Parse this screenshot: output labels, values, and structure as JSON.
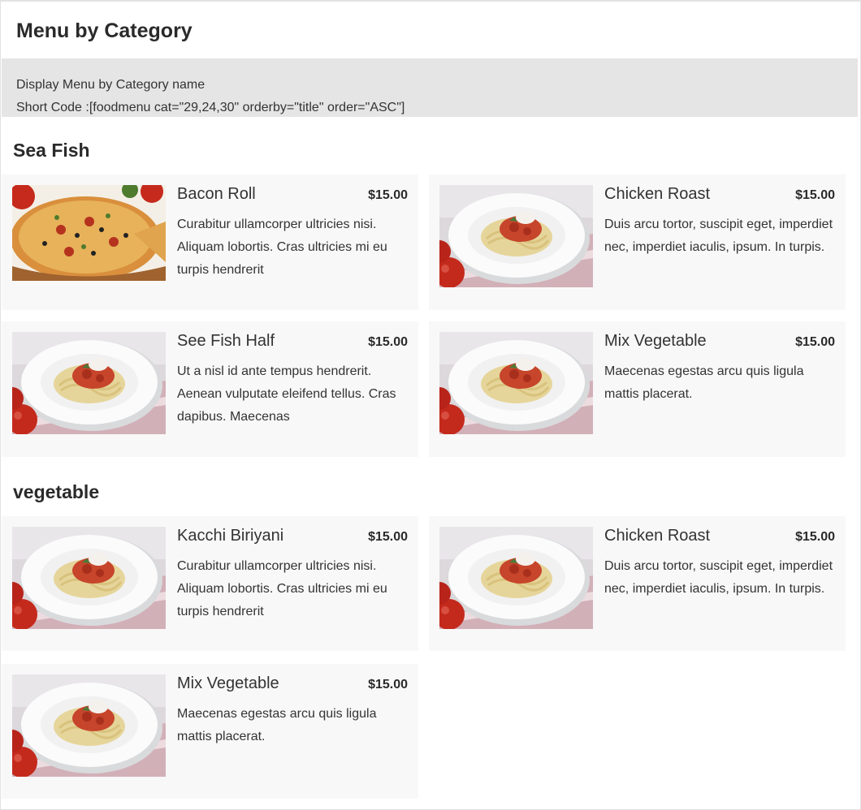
{
  "page": {
    "title": "Menu by Category",
    "info_line1": "Display Menu by Category name",
    "info_line2": "Short Code :[foodmenu cat=\"29,24,30\" orderby=\"title\" order=\"ASC\"]"
  },
  "categories": [
    {
      "name": "Sea Fish",
      "items": [
        {
          "title": "Bacon Roll",
          "price": "$15.00",
          "desc": "Curabitur ullamcorper ultricies nisi. Aliquam lobortis. Cras ultricies mi eu turpis hendrerit",
          "image": "pizza-image"
        },
        {
          "title": "Chicken Roast",
          "price": "$15.00",
          "desc": "Duis arcu tortor, suscipit eget, imperdiet nec, imperdiet iaculis, ipsum. In turpis.",
          "image": "pasta-image"
        },
        {
          "title": "See Fish Half",
          "price": "$15.00",
          "desc": "Ut a nisl id ante tempus hendrerit. Aenean vulputate eleifend tellus. Cras dapibus. Maecenas",
          "image": "pasta-image"
        },
        {
          "title": "Mix Vegetable",
          "price": "$15.00",
          "desc": "Maecenas egestas arcu quis ligula mattis placerat.",
          "image": "pasta-image"
        }
      ]
    },
    {
      "name": "vegetable",
      "items": [
        {
          "title": "Kacchi Biriyani",
          "price": "$15.00",
          "desc": "Curabitur ullamcorper ultricies nisi. Aliquam lobortis. Cras ultricies mi eu turpis hendrerit",
          "image": "pasta-image"
        },
        {
          "title": "Chicken Roast",
          "price": "$15.00",
          "desc": "Duis arcu tortor, suscipit eget, imperdiet nec, imperdiet iaculis, ipsum. In turpis.",
          "image": "pasta-image"
        },
        {
          "title": "Mix Vegetable",
          "price": "$15.00",
          "desc": "Maecenas egestas arcu quis ligula mattis placerat.",
          "image": "pasta-image"
        }
      ]
    }
  ]
}
